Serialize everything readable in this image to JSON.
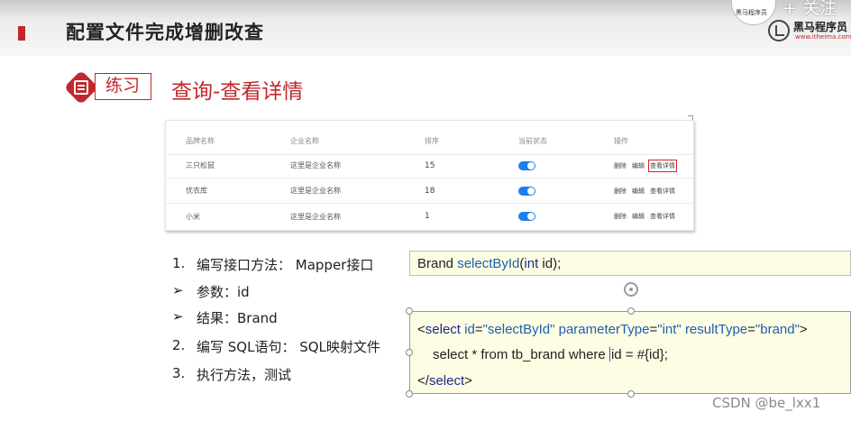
{
  "header": {
    "title": "配置文件完成增删改查",
    "follow_circle_text": "黑马程序员",
    "follow_label": "+ 关注",
    "brand_name": "黑马程序员",
    "brand_url": "www.itheima.com",
    "accent_color": "#c0282d"
  },
  "practice": {
    "tag": "练习",
    "title": "查询-查看详情"
  },
  "table": {
    "columns": [
      "品牌名称",
      "企业名称",
      "排序",
      "当前状态",
      "操作"
    ],
    "rows": [
      {
        "brand": "三只松鼠",
        "company": "这里是企业名称",
        "order": "15",
        "status": "on",
        "ops": [
          "删除",
          "编辑",
          "查看详情"
        ]
      },
      {
        "brand": "优衣库",
        "company": "这里是企业名称",
        "order": "18",
        "status": "on",
        "ops": [
          "删除",
          "编辑",
          "查看详情"
        ]
      },
      {
        "brand": "小米",
        "company": "这里是企业名称",
        "order": "1",
        "status": "on",
        "ops": [
          "删除",
          "编辑",
          "查看详情"
        ]
      }
    ],
    "highlighted_op": "查看详情",
    "toggle_color": "#1b7ff0"
  },
  "steps": [
    {
      "marker": "1.",
      "text": "编写接口方法： Mapper接口"
    },
    {
      "marker": "➢",
      "text": "参数：id"
    },
    {
      "marker": "➢",
      "text": "结果：Brand"
    },
    {
      "marker": "2.",
      "text": "编写 SQL语句： SQL映射文件"
    },
    {
      "marker": "3.",
      "text": "执行方法，测试"
    }
  ],
  "code1": {
    "type": "Brand",
    "method": "selectById",
    "param_type": "int",
    "param_name": "id",
    "open": "(",
    "close": ");"
  },
  "code2": {
    "line1_open": "<",
    "line1_tag": "select",
    "line1_attr1": "id",
    "line1_val1": "\"selectById\"",
    "line1_attr2": "parameterType",
    "line1_val2": "\"int\"",
    "line1_attr3": "resultType",
    "line1_val3": "\"brand\"",
    "line1_close": ">",
    "line2_before": "select * from tb_brand where ",
    "line2_after": "id = #{id};",
    "line3_open": "</",
    "line3_tag": "select",
    "line3_close": ">"
  },
  "watermark": "CSDN @be_lxx1"
}
